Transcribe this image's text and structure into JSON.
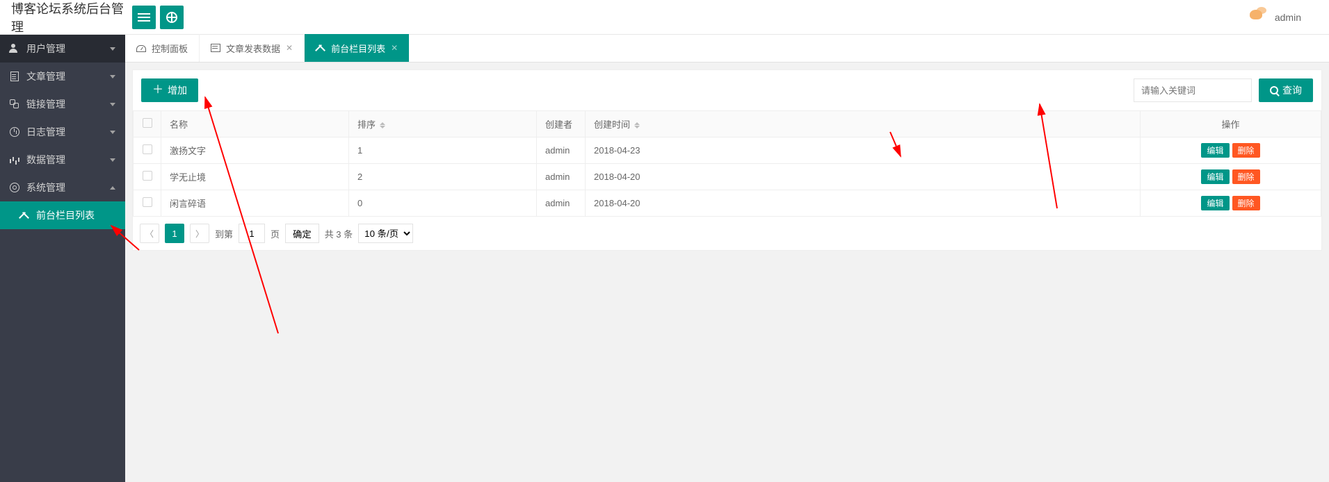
{
  "header": {
    "site_title": "博客论坛系统后台管理",
    "username": "admin"
  },
  "sidebar": {
    "items": [
      {
        "label": "用户管理"
      },
      {
        "label": "文章管理"
      },
      {
        "label": "链接管理"
      },
      {
        "label": "日志管理"
      },
      {
        "label": "数据管理"
      },
      {
        "label": "系统管理"
      }
    ],
    "sub_item": {
      "label": "前台栏目列表"
    }
  },
  "tabs": [
    {
      "label": "控制面板",
      "closable": false
    },
    {
      "label": "文章发表数据",
      "closable": true
    },
    {
      "label": "前台栏目列表",
      "closable": true,
      "active": true
    }
  ],
  "toolbar": {
    "add_label": "增加",
    "search_placeholder": "请输入关键词",
    "search_label": "查询"
  },
  "table": {
    "headers": {
      "name": "名称",
      "sort": "排序",
      "creator": "创建者",
      "created_at": "创建时间",
      "ops": "操作"
    },
    "edit_label": "编辑",
    "delete_label": "删除",
    "rows": [
      {
        "name": "激扬文字",
        "sort": "1",
        "creator": "admin",
        "created_at": "2018-04-23"
      },
      {
        "name": "学无止境",
        "sort": "2",
        "creator": "admin",
        "created_at": "2018-04-20"
      },
      {
        "name": "闲言碎语",
        "sort": "0",
        "creator": "admin",
        "created_at": "2018-04-20"
      }
    ]
  },
  "pager": {
    "current": "1",
    "goto_prefix": "到第",
    "goto_value": "1",
    "goto_suffix": "页",
    "go_label": "确定",
    "total_text": "共 3 条",
    "page_size": "10 条/页"
  }
}
